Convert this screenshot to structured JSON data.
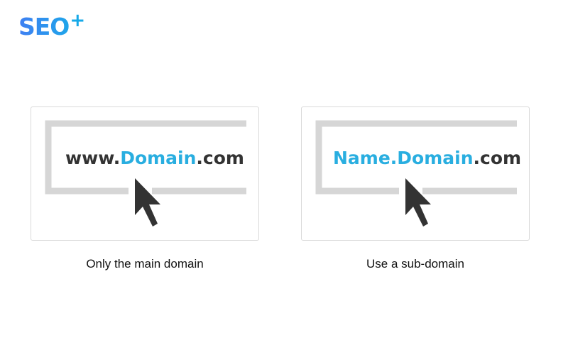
{
  "brand": {
    "logo_text": "SEO",
    "logo_plus": "+"
  },
  "cards": [
    {
      "url_parts": [
        {
          "text": "www.",
          "highlight": false
        },
        {
          "text": "Domain",
          "highlight": true
        },
        {
          "text": ".com",
          "highlight": false
        }
      ],
      "caption": "Only the main domain"
    },
    {
      "url_parts": [
        {
          "text": "Name.Domain",
          "highlight": true
        },
        {
          "text": ".com",
          "highlight": false
        }
      ],
      "caption": "Use a sub-domain"
    }
  ],
  "colors": {
    "highlight": "#29aee0",
    "text": "#333333",
    "frame": "#d6d6d6",
    "cursor": "#333333"
  }
}
